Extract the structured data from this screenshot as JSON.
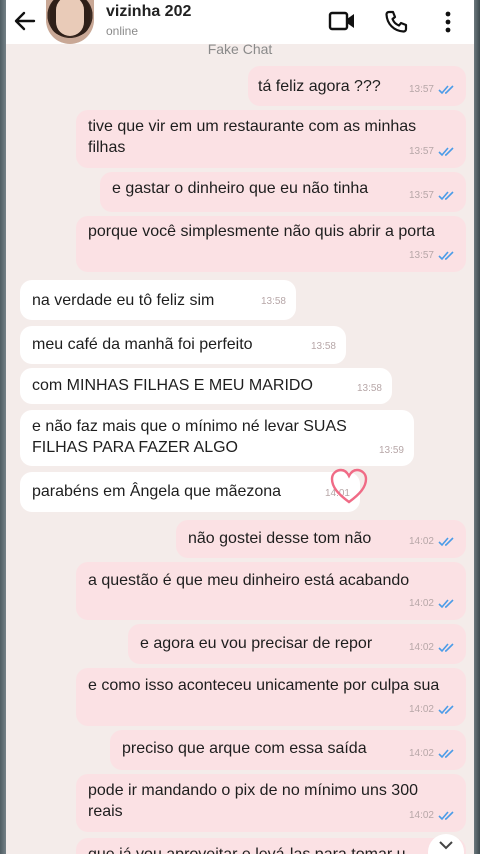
{
  "header": {
    "contact_name": "vizinha 202",
    "status": "online",
    "app_label": "Fake Chat"
  },
  "icons": [
    "back-arrow-icon",
    "avatar",
    "video-call-icon",
    "phone-call-icon",
    "more-vert-icon",
    "double-check-icon",
    "heart-icon",
    "chevron-down-icon"
  ],
  "colors": {
    "outgoing_bubble": "#fbe1e4",
    "incoming_bubble": "#ffffff",
    "chat_background": "#f4ecea",
    "read_ticks": "#4a9ce8"
  },
  "messages": [
    {
      "dir": "out",
      "text": "tá feliz agora ???",
      "time": "13:57"
    },
    {
      "dir": "out",
      "text": "tive que vir em um restaurante com as minhas filhas",
      "time": "13:57"
    },
    {
      "dir": "out",
      "text": "e gastar o dinheiro que eu não tinha",
      "time": "13:57"
    },
    {
      "dir": "out",
      "text": "porque você simplesmente não quis abrir a porta",
      "time": "13:57"
    },
    {
      "dir": "in",
      "text": "na verdade eu tô feliz sim",
      "time": "13:58"
    },
    {
      "dir": "in",
      "text": "meu café da manhã foi perfeito",
      "time": "13:58"
    },
    {
      "dir": "in",
      "text": "com MINHAS FILHAS E MEU MARIDO",
      "time": "13:58"
    },
    {
      "dir": "in",
      "text": "e não faz mais que o mínimo né levar SUAS FILHAS PARA FAZER ALGO",
      "time": "13:59"
    },
    {
      "dir": "in",
      "text": "parabéns em Ângela que mãezona",
      "time": "14:01"
    },
    {
      "dir": "out",
      "text": "não gostei desse tom não",
      "time": "14:02"
    },
    {
      "dir": "out",
      "text": "a questão é que meu dinheiro está acabando",
      "time": "14:02"
    },
    {
      "dir": "out",
      "text": "e agora eu vou precisar de repor",
      "time": "14:02"
    },
    {
      "dir": "out",
      "text": "e como isso aconteceu unicamente por culpa sua",
      "time": "14:02"
    },
    {
      "dir": "out",
      "text": "preciso que arque com essa saída",
      "time": "14:02"
    },
    {
      "dir": "out",
      "text": "pode ir mandando o pix de no mínimo uns 300 reais",
      "time": "14:02"
    },
    {
      "dir": "out",
      "text": "que já vou aproveitar e levá-las para tomar u",
      "time": ""
    }
  ]
}
